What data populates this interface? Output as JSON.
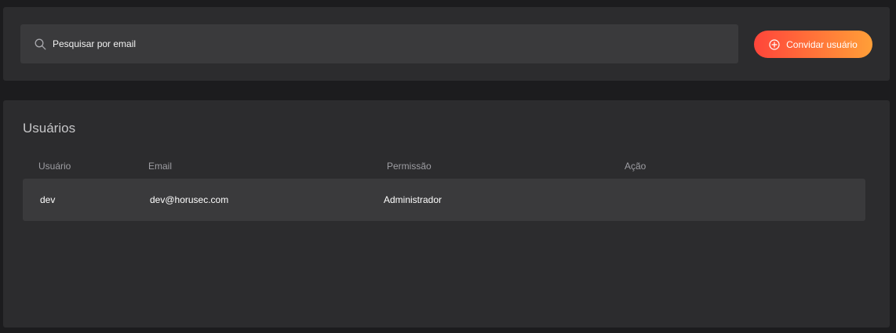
{
  "search": {
    "placeholder": "Pesquisar por email",
    "icon": "search-icon"
  },
  "invite_button": {
    "label": "Convidar usuário",
    "icon": "plus-circle-icon"
  },
  "colors": {
    "background": "#1c1c1e",
    "panel": "#2c2c2e",
    "row": "#3a3a3c",
    "accent_start": "#ff453a",
    "accent_end": "#ff9f38"
  },
  "users_table": {
    "title": "Usuários",
    "columns": [
      "Usuário",
      "Email",
      "Permissão",
      "Ação"
    ],
    "rows": [
      {
        "user": "dev",
        "email": "dev@horusec.com",
        "permission": "Administrador",
        "action": ""
      }
    ]
  }
}
